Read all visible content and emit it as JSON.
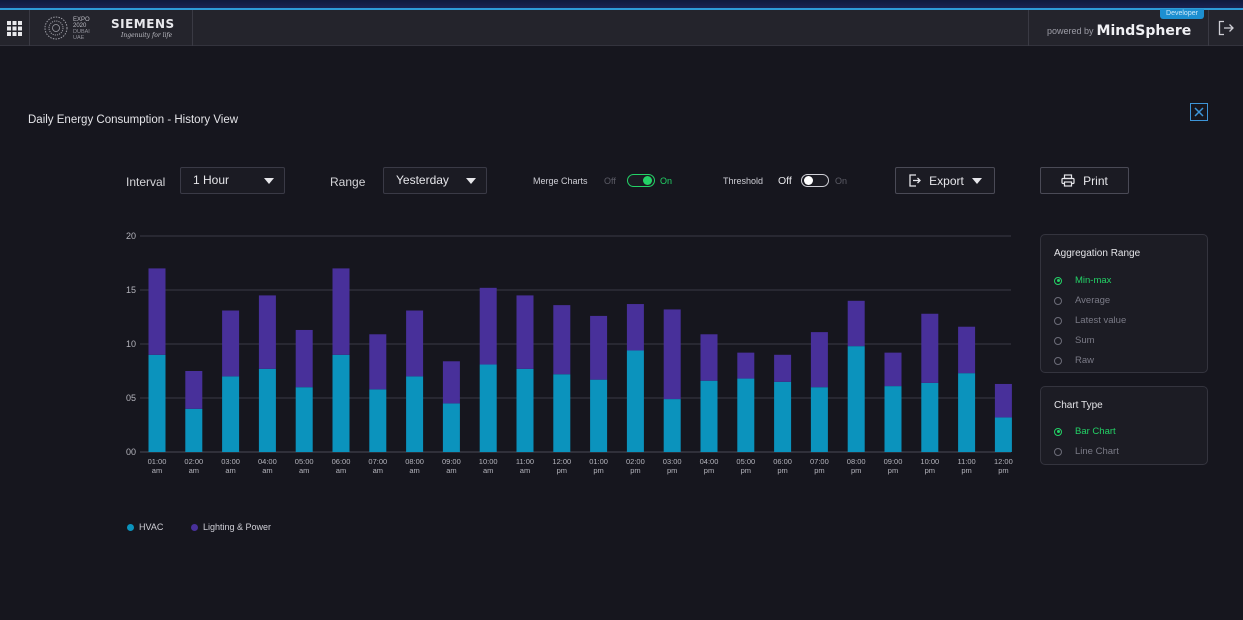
{
  "header": {
    "expo_logo_text": [
      "EXPO",
      "2020",
      "DUBAI",
      "UAE"
    ],
    "brand_name": "SIEMENS",
    "brand_tagline": "Ingenuity for life",
    "powered_by": "powered by",
    "platform": "MindSphere",
    "badge": "Developer"
  },
  "page": {
    "title": "Daily Energy Consumption - History View"
  },
  "controls": {
    "interval_label": "Interval",
    "interval_value": "1 Hour",
    "range_label": "Range",
    "range_value": "Yesterday",
    "merge_label": "Merge Charts",
    "merge_off": "Off",
    "merge_on": "On",
    "merge_state": true,
    "threshold_label": "Threshold",
    "threshold_off": "Off",
    "threshold_on": "On",
    "threshold_state": false,
    "export_label": "Export",
    "print_label": "Print"
  },
  "aggregation": {
    "title": "Aggregation Range",
    "options": [
      "Min-max",
      "Average",
      "Latest value",
      "Sum",
      "Raw"
    ],
    "selected": "Min-max"
  },
  "chart_type_panel": {
    "title": "Chart Type",
    "options": [
      "Bar Chart",
      "Line Chart"
    ],
    "selected": "Bar Chart"
  },
  "colors": {
    "hvac": "#0b93bd",
    "lighting": "#48309a",
    "accent_green": "#23d266",
    "accent_blue": "#3d95d8"
  },
  "chart_data": {
    "type": "bar",
    "stacked": true,
    "categories": [
      "01:00|am",
      "02:00|am",
      "03:00|am",
      "04:00|am",
      "05:00|am",
      "06:00|am",
      "07:00|am",
      "08:00|am",
      "09:00|am",
      "10:00|am",
      "11:00|am",
      "12:00|pm",
      "01:00|pm",
      "02:00|pm",
      "03:00|pm",
      "04:00|pm",
      "05:00|pm",
      "06:00|pm",
      "07:00|pm",
      "08:00|pm",
      "09:00|pm",
      "10:00|pm",
      "11:00|pm",
      "12:00|pm"
    ],
    "series": [
      {
        "name": "HVAC",
        "values": [
          9,
          4,
          7,
          7.7,
          6,
          9,
          5.8,
          7,
          4.5,
          8.1,
          7.7,
          7.2,
          6.7,
          9.4,
          4.9,
          6.6,
          6.8,
          6.5,
          6,
          9.8,
          6.1,
          6.4,
          7.3,
          3.2
        ]
      },
      {
        "name": "Lighting & Power",
        "values": [
          8,
          3.5,
          6.1,
          6.8,
          5.3,
          8,
          5.1,
          6.1,
          3.9,
          7.1,
          6.8,
          6.4,
          5.9,
          4.3,
          8.3,
          4.3,
          2.4,
          2.5,
          5.1,
          4.2,
          3.1,
          6.4,
          4.3,
          3.1
        ]
      }
    ],
    "y_ticks": [
      "00",
      "05",
      "10",
      "15",
      "20"
    ],
    "ylim": [
      0,
      20
    ],
    "grid": true,
    "legend": "bottom-left"
  }
}
